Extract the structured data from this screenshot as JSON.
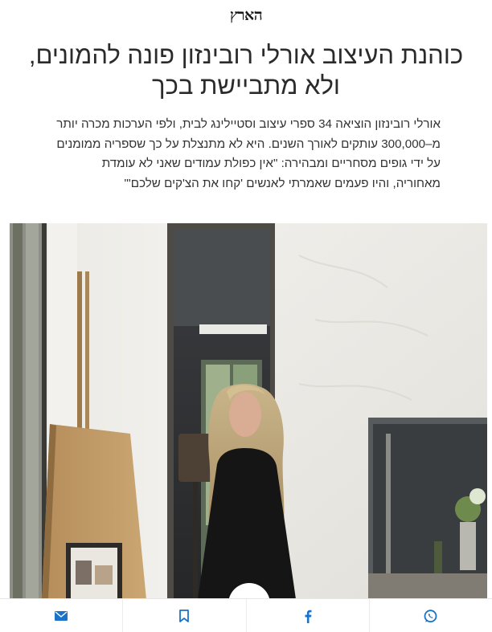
{
  "header": {
    "logo_text": "הארץ"
  },
  "article": {
    "headline": "כוהנת העיצוב אורלי רובינזון פונה להמונים, ולא מתביישת בכך",
    "subhead": "אורלי רובינזון הוציאה 34 ספרי עיצוב וסטיילינג לבית, ולפי הערכות מכרה יותר מ–300,000 עותקים לאורך השנים. היא לא מתנצלת על כך שספריה ממומנים על ידי גופים מסחריים ומבהירה: \"אין כפולת עמודים שאני לא עומדת מאחוריה, והיו פעמים שאמרתי לאנשים 'קחו את הצ'קים שלכם'\""
  },
  "hero": {
    "icon": "photo-of-woman-in-doorway"
  },
  "bottom_bar": {
    "buttons": [
      {
        "id": "email",
        "icon": "mail-icon",
        "color": "#1a73c9"
      },
      {
        "id": "save",
        "icon": "bookmark-icon",
        "color": "#1a73c9"
      },
      {
        "id": "facebook",
        "icon": "facebook-icon",
        "color": "#1a73c9"
      },
      {
        "id": "whatsapp",
        "icon": "whatsapp-icon",
        "color": "#1a73c9"
      }
    ]
  },
  "colors": {
    "accent": "#1a73c9",
    "text": "#222222"
  }
}
